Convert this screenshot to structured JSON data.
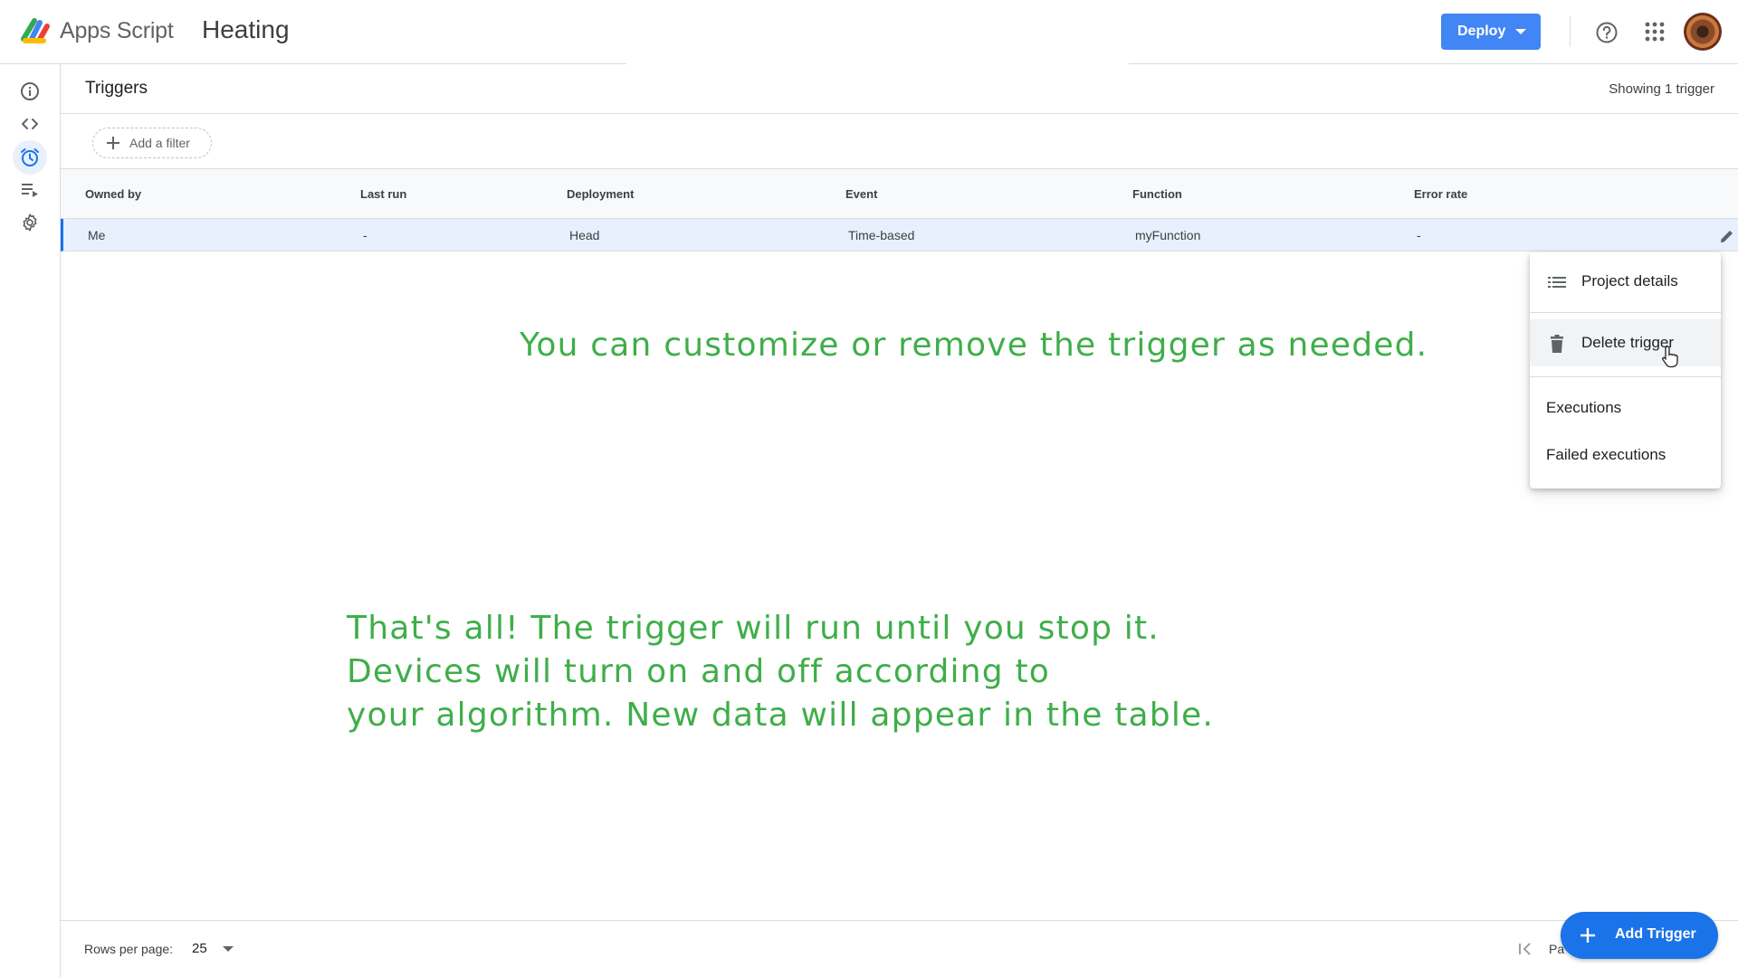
{
  "header": {
    "app_name": "Apps Script",
    "project_name": "Heating",
    "deploy_label": "Deploy"
  },
  "rail": {
    "items": [
      {
        "name": "overview",
        "icon": "info-icon"
      },
      {
        "name": "editor",
        "icon": "code-icon"
      },
      {
        "name": "triggers",
        "icon": "alarm-clock-icon",
        "active": true
      },
      {
        "name": "executions",
        "icon": "playlist-play-icon"
      },
      {
        "name": "settings",
        "icon": "gear-icon"
      }
    ]
  },
  "page": {
    "title": "Triggers",
    "showing": "Showing 1 trigger",
    "filter_label": "Add a filter"
  },
  "table": {
    "columns": [
      "Owned by",
      "Last run",
      "Deployment",
      "Event",
      "Function",
      "Error rate"
    ],
    "rows": [
      {
        "owned_by": "Me",
        "last_run": "-",
        "deployment": "Head",
        "event": "Time-based",
        "function": "myFunction",
        "error_rate": "-"
      }
    ]
  },
  "menu": {
    "project_details": "Project details",
    "delete_trigger": "Delete trigger",
    "executions": "Executions",
    "failed_executions": "Failed executions"
  },
  "annotations": {
    "note_1": "You can customize or remove the trigger as needed.",
    "note_2_line_1": "That's all! The trigger will run until you stop it.",
    "note_2_line_2": "Devices will turn on and off according to",
    "note_2_line_3": "your algorithm. New data will appear in the table."
  },
  "footer": {
    "rows_per_page_label": "Rows per page:",
    "rows_per_page_value": "25",
    "page_text": "Pa",
    "add_trigger_label": "Add Trigger"
  },
  "colors": {
    "accent": "#1a73e8",
    "deploy": "#4285f4",
    "annotation": "#3fae49",
    "selected_row": "#e8f0fe"
  }
}
